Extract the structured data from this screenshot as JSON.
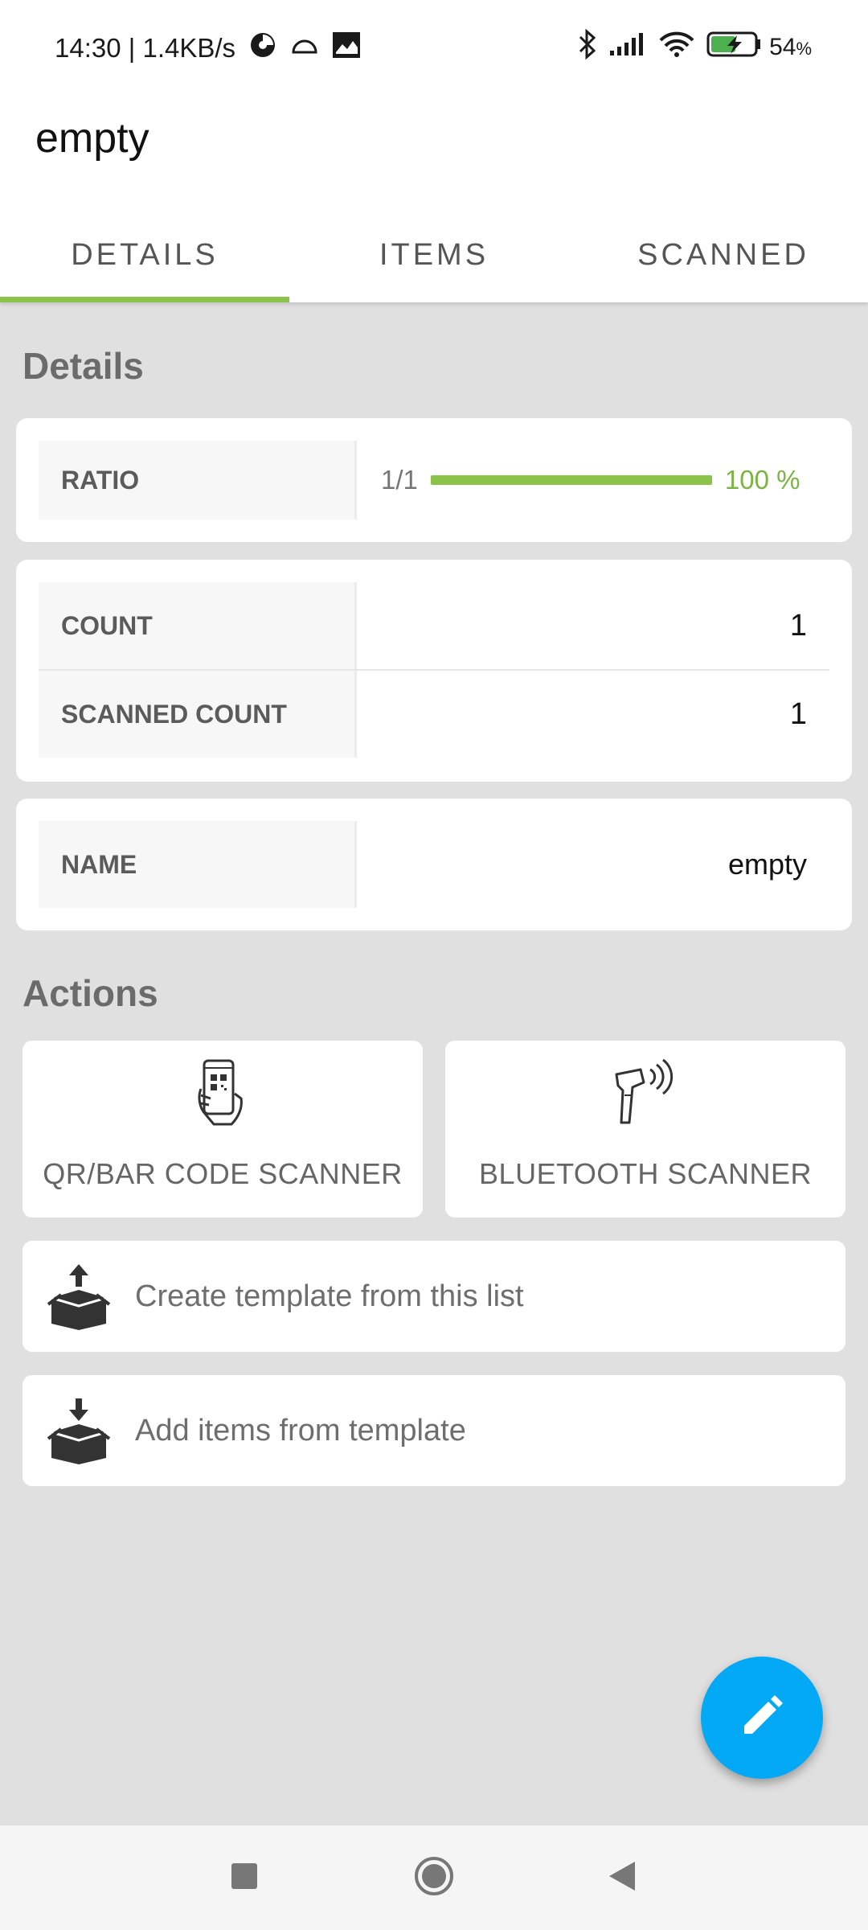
{
  "status_bar": {
    "time": "14:30 | 1.4KB/s",
    "battery": "54",
    "battery_unit": "%"
  },
  "app": {
    "title": "empty"
  },
  "tabs": [
    {
      "label": "DETAILS",
      "active": true
    },
    {
      "label": "ITEMS",
      "active": false
    },
    {
      "label": "SCANNED",
      "active": false
    }
  ],
  "details": {
    "section_title": "Details",
    "ratio": {
      "label": "RATIO",
      "fraction": "1/1",
      "progress": 1.0,
      "percent": "100 %"
    },
    "count": {
      "label": "COUNT",
      "value": "1"
    },
    "scanned_count": {
      "label": "SCANNED COUNT",
      "value": "1"
    },
    "name": {
      "label": "NAME",
      "value": "empty"
    }
  },
  "actions": {
    "section_title": "Actions",
    "qr_scanner": {
      "label": "QR/BAR CODE SCANNER",
      "icon": "phone-qr-icon"
    },
    "bt_scanner": {
      "label": "BLUETOOTH SCANNER",
      "icon": "barcode-gun-icon"
    },
    "create_template": {
      "label": "Create template from this list",
      "icon": "box-upload-icon"
    },
    "add_from_template": {
      "label": "Add items from template",
      "icon": "box-download-icon"
    }
  },
  "fab": {
    "icon": "pencil-icon"
  },
  "colors": {
    "accent_green": "#8bc34a",
    "fab_blue": "#03a9f4",
    "background": "#e0e0e0"
  }
}
